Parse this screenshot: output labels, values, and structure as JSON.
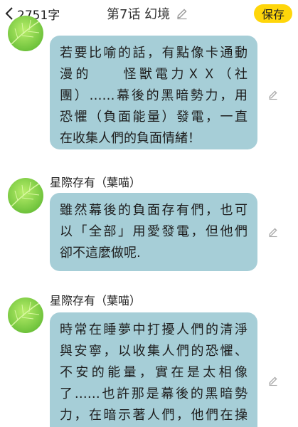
{
  "header": {
    "back_icon": "chevron-left-icon",
    "word_count": "2751字",
    "title": "第7话 幻境",
    "title_edit_icon": "pencil-icon",
    "save_label": "保存",
    "accent_color": "#ffd60a"
  },
  "bubble_color": "#a6ced7",
  "messages": [
    {
      "speaker": "",
      "avatar_icon": "green-leaf-avatar",
      "edit_icon": "pencil-icon",
      "lines": [
        "若要比喻的話，有點像卡通動",
        "漫的　　怪獸電力ＸＸ（社",
        "團）……幕後的黑暗勢力，用",
        "恐懼（負面能量）發電，一直",
        "在收集人們的負面情緒！"
      ]
    },
    {
      "speaker": "星際存有（葉喵）",
      "avatar_icon": "green-leaf-avatar",
      "edit_icon": "pencil-icon",
      "lines": [
        "雖然幕後的負面存有們，也可",
        "以「全部」用愛發電，但他們",
        "卻不這麼做呢."
      ]
    },
    {
      "speaker": "星際存有（葉喵）",
      "avatar_icon": "green-leaf-avatar",
      "edit_icon": "pencil-icon",
      "lines": [
        "時常在睡夢中打擾人們的清淨",
        "與安寧，以收集人們的恐懼、",
        "不安的能量，實在是太相像",
        "了……也許那是幕後的黑暗勢",
        "力，在暗示著人們，他們在操"
      ]
    }
  ]
}
